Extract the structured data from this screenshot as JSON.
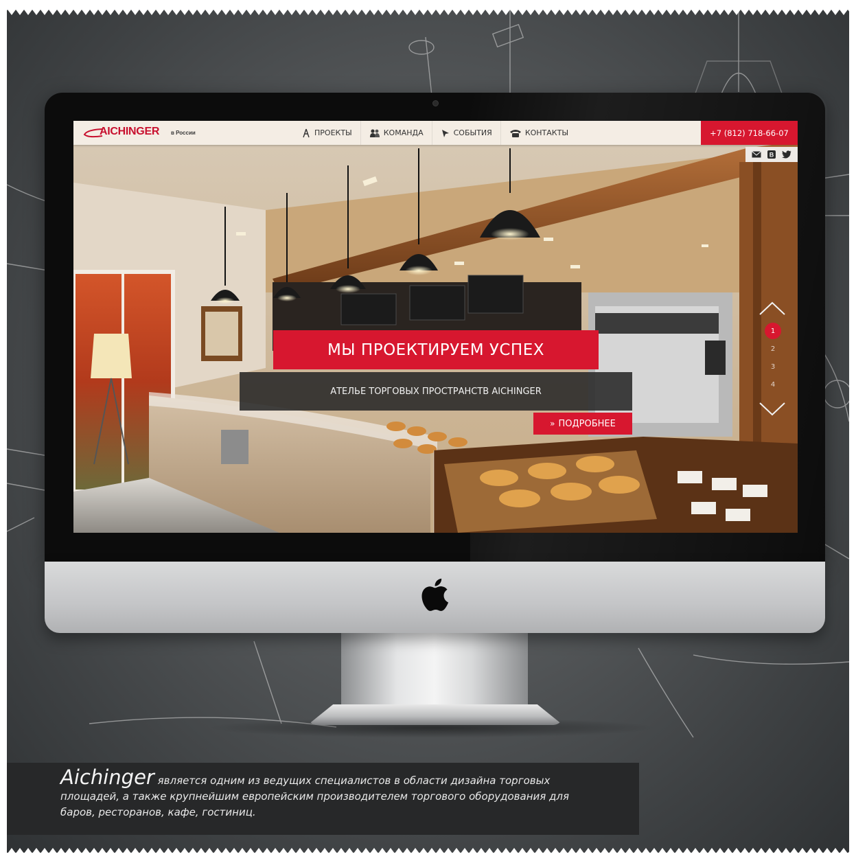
{
  "site": {
    "brand_name": "AICHINGER",
    "brand_sub": "в России",
    "nav": [
      {
        "label": "ПРОЕКТЫ",
        "icon": "compass-icon"
      },
      {
        "label": "КОМАНДА",
        "icon": "people-icon"
      },
      {
        "label": "СОБЫТИЯ",
        "icon": "cursor-icon"
      },
      {
        "label": "КОНТАКТЫ",
        "icon": "phone-icon"
      }
    ],
    "phone": "+7 (812) 718-66-07",
    "social": [
      "mail-icon",
      "vk-icon",
      "twitter-icon"
    ],
    "hero_title": "МЫ ПРОЕКТИРУЕМ УСПЕХ",
    "hero_subtitle": "АТЕЛЬЕ ТОРГОВЫХ ПРОСТРАНСТВ AICHINGER",
    "more_button": "ПОДРОБНЕЕ",
    "more_button_icon": "double-chevron-right-icon",
    "pager": {
      "pages": [
        "1",
        "2",
        "3",
        "4"
      ],
      "active": "1",
      "up_icon": "chevron-up-icon",
      "down_icon": "chevron-down-icon"
    }
  },
  "caption": {
    "brand": "Aichinger",
    "text": " является одним из ведущих специалистов в области дизайна торговых площадей, а также крупнейшим европейским производителем торгового оборудования для баров, ресторанов, кафе, гостиниц."
  },
  "colors": {
    "accent": "#d7172f",
    "chalkboard": "#55585a",
    "caption_bg": "#272829"
  }
}
